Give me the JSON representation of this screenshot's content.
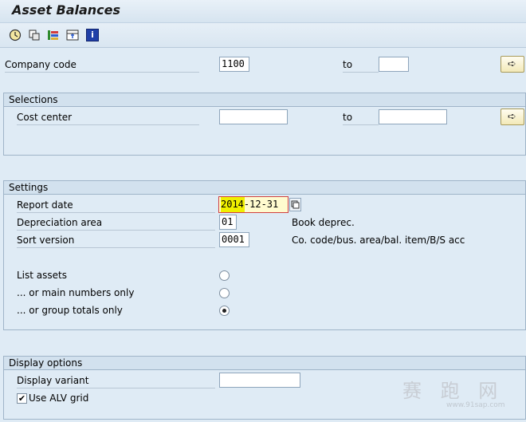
{
  "title": "Asset Balances",
  "toolbar": {
    "icons": [
      "execute-icon",
      "copy-icon",
      "selection-options-icon",
      "dynamic-selections-icon",
      "info-icon"
    ]
  },
  "company": {
    "label": "Company code",
    "from": "1100",
    "to_label": "to",
    "to": ""
  },
  "selections": {
    "header": "Selections",
    "cost_center_label": "Cost center",
    "from": "",
    "to_label": "to",
    "to": ""
  },
  "settings": {
    "header": "Settings",
    "report_date_label": "Report date",
    "report_date": "2014-12-31",
    "dep_area_label": "Depreciation area",
    "dep_area": "01",
    "dep_area_desc": "Book deprec.",
    "sort_version_label": "Sort version",
    "sort_version": "0001",
    "sort_version_desc": "Co. code/bus. area/bal. item/B/S acc",
    "list_assets_label": "List assets",
    "main_numbers_label": "... or main numbers only",
    "group_totals_label": "... or group totals only",
    "selected_option": "group_totals"
  },
  "display": {
    "header": "Display options",
    "variant_label": "Display variant",
    "variant": "",
    "alv_label": "Use ALV grid",
    "alv_checked": true
  },
  "watermark": {
    "text": "赛 跑 网",
    "url": "www.91sap.com"
  }
}
